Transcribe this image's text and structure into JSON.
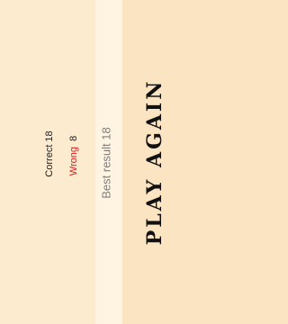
{
  "results": {
    "correct_label": "Correct",
    "correct_value": "18",
    "wrong_label": "Wrong",
    "wrong_value": "8",
    "best_label": "Best result",
    "best_value": "18"
  },
  "actions": {
    "play_again_label": "PLAY AGAIN"
  },
  "colors": {
    "background": "#fbe4c2",
    "wrong_label": "#d31f1f",
    "best_text": "#7d7d7d"
  }
}
